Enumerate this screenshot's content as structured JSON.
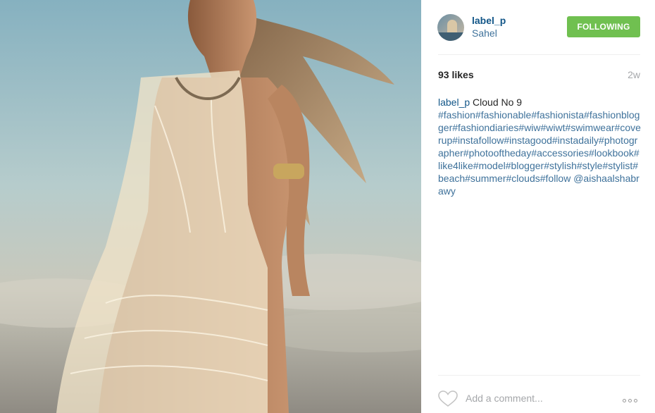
{
  "post": {
    "username": "label_p",
    "location": "Sahel",
    "follow_label": "FOLLOWING",
    "likes": "93 likes",
    "time_ago": "2w",
    "caption_user": "label_p",
    "caption_text": " Cloud No 9",
    "caption_tags": "#fashion#fashionable#fashionista#fashionblogger#fashiondiaries#wiw#wiwt#swimwear#coverup#instafollow#instagood#instadaily#photographer#photooftheday#accessories#lookbook#like4like#model#blogger#stylish#style#stylist#beach#summer#clouds#follow @aishaalshabrawy"
  },
  "comment": {
    "placeholder": "Add a comment..."
  },
  "colors": {
    "follow_button": "#70c050",
    "username": "#125688",
    "hashtag": "#3f729b"
  },
  "icons": {
    "like": "heart-outline-icon",
    "more": "more-options-icon"
  }
}
